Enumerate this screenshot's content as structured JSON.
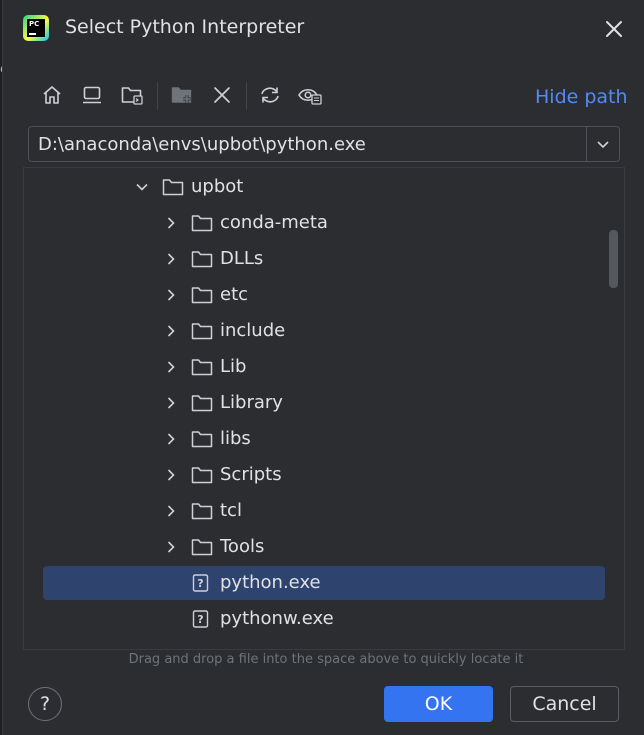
{
  "dialog": {
    "title": "Select Python Interpreter",
    "app_logo_text": "PC"
  },
  "toolbar": {
    "buttons": [
      "home-icon",
      "desktop-icon",
      "project-folder-icon",
      "new-folder-icon",
      "delete-icon",
      "refresh-icon",
      "show-hidden-icon"
    ],
    "hide_path_label": "Hide path"
  },
  "path": {
    "value": "D:\\anaconda\\envs\\upbot\\python.exe"
  },
  "tree": {
    "items": [
      {
        "label": "upbot",
        "kind": "folder",
        "expanded": true,
        "level": 0
      },
      {
        "label": "conda-meta",
        "kind": "folder",
        "expanded": false,
        "level": 1
      },
      {
        "label": "DLLs",
        "kind": "folder",
        "expanded": false,
        "level": 1
      },
      {
        "label": "etc",
        "kind": "folder",
        "expanded": false,
        "level": 1
      },
      {
        "label": "include",
        "kind": "folder",
        "expanded": false,
        "level": 1
      },
      {
        "label": "Lib",
        "kind": "folder",
        "expanded": false,
        "level": 1
      },
      {
        "label": "Library",
        "kind": "folder",
        "expanded": false,
        "level": 1
      },
      {
        "label": "libs",
        "kind": "folder",
        "expanded": false,
        "level": 1
      },
      {
        "label": "Scripts",
        "kind": "folder",
        "expanded": false,
        "level": 1
      },
      {
        "label": "tcl",
        "kind": "folder",
        "expanded": false,
        "level": 1
      },
      {
        "label": "Tools",
        "kind": "folder",
        "expanded": false,
        "level": 1
      },
      {
        "label": "python.exe",
        "kind": "file",
        "selected": true,
        "level": 1
      },
      {
        "label": "pythonw.exe",
        "kind": "file",
        "level": 1
      }
    ]
  },
  "hint": "Drag and drop a file into the space above to quickly locate it",
  "buttons": {
    "help": "?",
    "ok": "OK",
    "cancel": "Cancel"
  },
  "colors": {
    "background": "#2b2d30",
    "accent": "#3574f0",
    "selection": "#2e436e",
    "link": "#548af7"
  }
}
